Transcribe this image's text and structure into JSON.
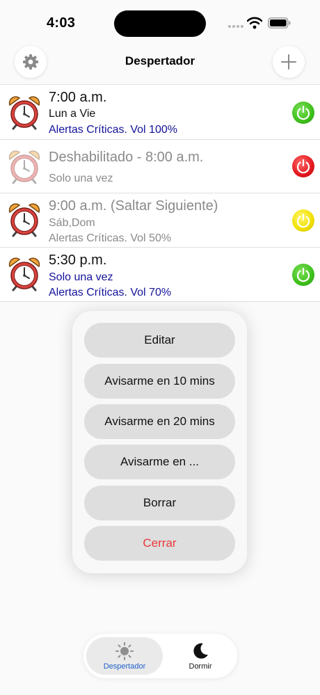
{
  "status_bar": {
    "time": "4:03"
  },
  "nav": {
    "title": "Despertador"
  },
  "alarms": [
    {
      "title": "7:00 a.m.",
      "days": "Lun a Vie",
      "alerts": "Alertas Críticas. Vol 100%",
      "state": "on"
    },
    {
      "title": "Deshabilitado - 8:00 a.m.",
      "days": "Solo una vez",
      "state": "off"
    },
    {
      "title": "9:00 a.m. (Saltar Siguiente)",
      "days": "Sáb,Dom",
      "alerts": "Alertas Críticas. Vol 50%",
      "state": "skip"
    },
    {
      "title": "5:30 p.m.",
      "days": "Solo una vez",
      "alerts": "Alertas Críticas. Vol 70%",
      "state": "on"
    }
  ],
  "popup": {
    "edit": "Editar",
    "snooze_10": "Avisarme en 10 mins",
    "snooze_20": "Avisarme en 20 mins",
    "snooze_custom": "Avisarme en ...",
    "delete": "Borrar",
    "close": "Cerrar"
  },
  "tabs": {
    "alarm": "Despertador",
    "sleep": "Dormir"
  },
  "colors": {
    "on": "#3cbf1a",
    "off": "#e2171d",
    "skip": "#f0e000",
    "link_blue": "#13129a",
    "danger": "#e8383b"
  },
  "icons": {
    "settings": "gear-icon",
    "add": "plus-icon",
    "alarm_clock": "alarm-clock-icon",
    "power": "power-icon",
    "sun": "sun-icon",
    "moon": "moon-icon"
  }
}
